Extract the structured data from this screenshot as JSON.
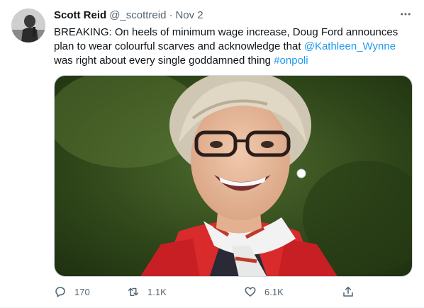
{
  "tweet": {
    "author": {
      "display_name": "Scott Reid",
      "handle": "@_scottreid"
    },
    "separator": "·",
    "date": "Nov 2",
    "text": {
      "part1": "BREAKING: On heels of minimum wage increase, Doug Ford announces plan to wear colourful scarves and acknowledge that ",
      "mention": "@Kathleen_Wynne",
      "part2": " was right about every single goddamned thing ",
      "hashtag": "#onpoli"
    },
    "actions": {
      "replies": "170",
      "retweets": "1.1K",
      "likes": "6.1K"
    },
    "icons": {
      "more": "more-horizontal-icon",
      "reply": "reply-icon",
      "retweet": "retweet-icon",
      "like": "heart-icon",
      "share": "share-icon"
    },
    "colors": {
      "link": "#1d9bf0",
      "secondary_text": "#536471",
      "primary_text": "#0f1419"
    }
  }
}
